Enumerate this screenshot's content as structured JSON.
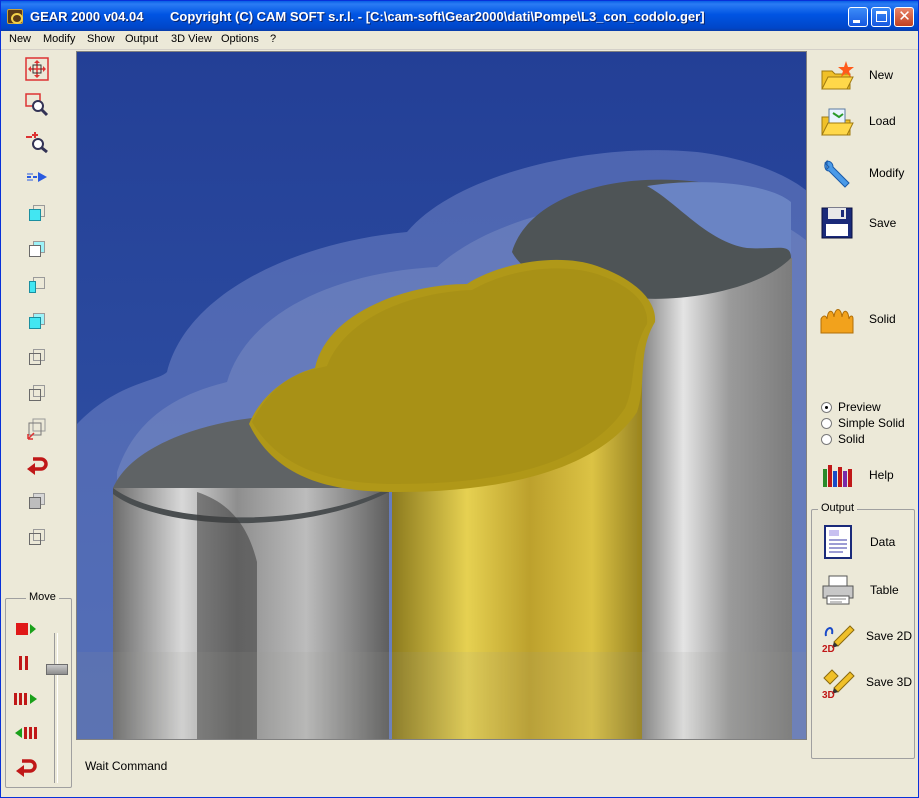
{
  "window": {
    "app_name": "GEAR 2000 v04.04",
    "title_path": "Copyright (C)  CAM SOFT s.r.l. - [C:\\cam-soft\\Gear2000\\dati\\Pompe\\L3_con_codolo.ger]",
    "close_glyph": "✕"
  },
  "menu": [
    "New",
    "Modify",
    "Show",
    "Output",
    "3D View",
    "Options",
    "?"
  ],
  "left_tools": [
    "fit-view",
    "zoom-window",
    "zoom-in-out",
    "pan",
    "view-front",
    "view-top",
    "view-left",
    "view-right",
    "view-back",
    "view-bottom",
    "view-axes",
    "undo-view",
    "view-solid",
    "view-wireframe"
  ],
  "move": {
    "label": "Move",
    "controls": [
      "play",
      "pause",
      "step-forward",
      "step-back",
      "reset"
    ],
    "slider_value": 0.22
  },
  "status": "Wait Command",
  "right_buttons": {
    "new": "New",
    "load": "Load",
    "modify": "Modify",
    "save": "Save",
    "solid": "Solid",
    "help": "Help"
  },
  "render_mode": {
    "options": [
      "Preview",
      "Simple Solid",
      "Solid"
    ],
    "selected": "Preview"
  },
  "output": {
    "label": "Output",
    "buttons": {
      "data": "Data",
      "table": "Table",
      "save2d": "Save 2D",
      "save3d": "Save 3D"
    },
    "icon_tags": {
      "save2d": "2D",
      "save3d": "3D"
    }
  },
  "colors": {
    "viewport_bg": "#2b4a9c",
    "gear_gold": "#c9b02a",
    "cylinder_grey": "#8c8c8c"
  }
}
